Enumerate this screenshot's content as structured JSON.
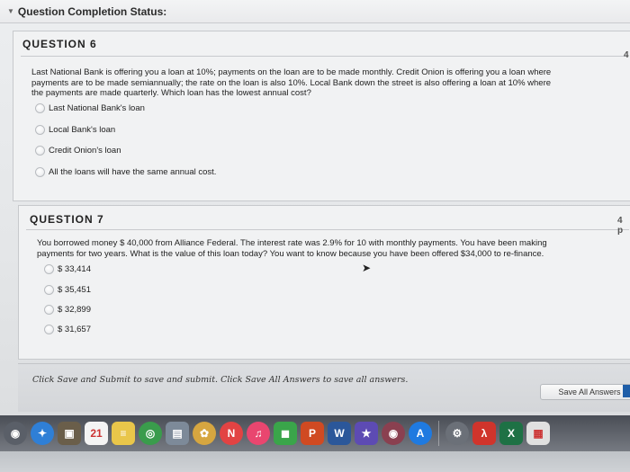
{
  "status": {
    "title": "Question Completion Status:"
  },
  "question6": {
    "heading": "QUESTION 6",
    "lines": [
      "Last National Bank is offering you a loan at 10%; payments on the loan are to be made monthly. Credit Onion is offering you a loan where",
      "payments are to be made semiannually; the rate on the loan is also 10%. Local Bank down the street is also offering a loan at 10% where",
      "the payments are made quarterly. Which loan has the lowest annual cost?"
    ],
    "options": [
      "Last National Bank's loan",
      "Local Bank's loan",
      "Credit Onion's loan",
      "All the loans will have the same annual cost."
    ]
  },
  "question7": {
    "heading": "QUESTION 7",
    "lines": [
      "You borrowed money $ 40,000 from Alliance Federal. The interest rate was 2.9% for 10 with monthly payments. You have been making",
      "payments for two years. What is the value of this loan today? You want to know because you have been offered $34,000 to re-finance."
    ],
    "options": [
      "$ 33,414",
      "$ 35,451",
      "$ 32,899",
      "$ 31,657"
    ]
  },
  "edge_numbers": {
    "right_upper": "4",
    "right_lower": "4 p"
  },
  "footer": {
    "note": "Click Save and Submit to save and submit. Click Save All Answers to save all answers.",
    "save_all_label": "Save All Answers"
  },
  "dock": {
    "calendar_date": "21",
    "items": [
      {
        "name": "launchpad",
        "glyph": "◉",
        "color": "#5a5f68"
      },
      {
        "name": "safari",
        "glyph": "✦",
        "color": "#2f7fd6"
      },
      {
        "name": "photos-app",
        "glyph": "▣",
        "color": "#6a5e4a"
      },
      {
        "name": "calendar",
        "glyph": "21",
        "color": "#f4f4f4"
      },
      {
        "name": "notes",
        "glyph": "≡",
        "color": "#e9c64a"
      },
      {
        "name": "chrome",
        "glyph": "◎",
        "color": "#3a9c4c"
      },
      {
        "name": "preview",
        "glyph": "▤",
        "color": "#7d8a99"
      },
      {
        "name": "photos",
        "glyph": "✿",
        "color": "#d6a640"
      },
      {
        "name": "news",
        "glyph": "N",
        "color": "#e24343"
      },
      {
        "name": "music",
        "glyph": "♫",
        "color": "#e9466f"
      },
      {
        "name": "facetime",
        "glyph": "◼",
        "color": "#3aa54a"
      },
      {
        "name": "powerpoint",
        "glyph": "P",
        "color": "#d04a22"
      },
      {
        "name": "word",
        "glyph": "W",
        "color": "#2b579a"
      },
      {
        "name": "imovie",
        "glyph": "★",
        "color": "#5d4bb3"
      },
      {
        "name": "photobooth",
        "glyph": "◉",
        "color": "#8a4050"
      },
      {
        "name": "app-store",
        "glyph": "A",
        "color": "#1f7ae0"
      },
      {
        "name": "system-preferences",
        "glyph": "⚙",
        "color": "#6b7078"
      },
      {
        "name": "acrobat",
        "glyph": "λ",
        "color": "#d0342c"
      },
      {
        "name": "excel",
        "glyph": "X",
        "color": "#1e7145"
      },
      {
        "name": "notes-2",
        "glyph": "▦",
        "color": "#e0e0e0"
      }
    ]
  }
}
